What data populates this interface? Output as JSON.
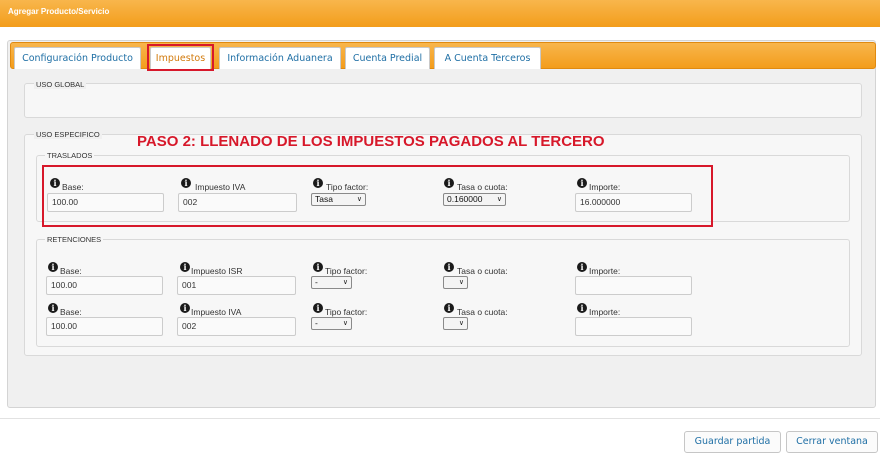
{
  "window": {
    "title": "Agregar Producto/Servicio"
  },
  "tabs": [
    {
      "label": "Configuración Producto"
    },
    {
      "label": "Impuestos"
    },
    {
      "label": "Información Aduanera"
    },
    {
      "label": "Cuenta Predial"
    },
    {
      "label": "A Cuenta Terceros"
    }
  ],
  "uso_global": {
    "label": "USO GLOBAL"
  },
  "uso_especifico": {
    "label": "USO ESPECIFICO"
  },
  "banner": "PASO 2: LLENADO DE LOS IMPUESTOS PAGADOS AL TERCERO",
  "traslados": {
    "label": "TRASLADOS",
    "row": {
      "base_label": "Base:",
      "base_value": "100.00",
      "impuesto_label": "Impuesto IVA",
      "impuesto_value": "002",
      "tipo_label": "Tipo factor:",
      "tipo_value": "Tasa",
      "tasa_label": "Tasa o cuota:",
      "tasa_value": "0.160000",
      "importe_label": "Importe:",
      "importe_value": "16.000000"
    }
  },
  "retenciones": {
    "label": "RETENCIONES",
    "rows": [
      {
        "base_label": "Base:",
        "base_value": "100.00",
        "impuesto_label": "Impuesto ISR",
        "impuesto_value": "001",
        "tipo_label": "Tipo factor:",
        "tipo_value": "-",
        "tasa_label": "Tasa o cuota:",
        "tasa_value": "",
        "importe_label": "Importe:",
        "importe_value": ""
      },
      {
        "base_label": "Base:",
        "base_value": "100.00",
        "impuesto_label": "Impuesto IVA",
        "impuesto_value": "002",
        "tipo_label": "Tipo factor:",
        "tipo_value": "-",
        "tasa_label": "Tasa o cuota:",
        "tasa_value": "",
        "importe_label": "Importe:",
        "importe_value": ""
      }
    ]
  },
  "buttons": {
    "guardar": "Guardar partida",
    "cerrar": "Cerrar ventana"
  },
  "colors": {
    "accent": "#f39d1b",
    "link": "#1f6fa5",
    "highlight": "#d7182a"
  },
  "icons": {
    "info": "info-circle-icon",
    "dropdown": "chevron-down-icon"
  }
}
